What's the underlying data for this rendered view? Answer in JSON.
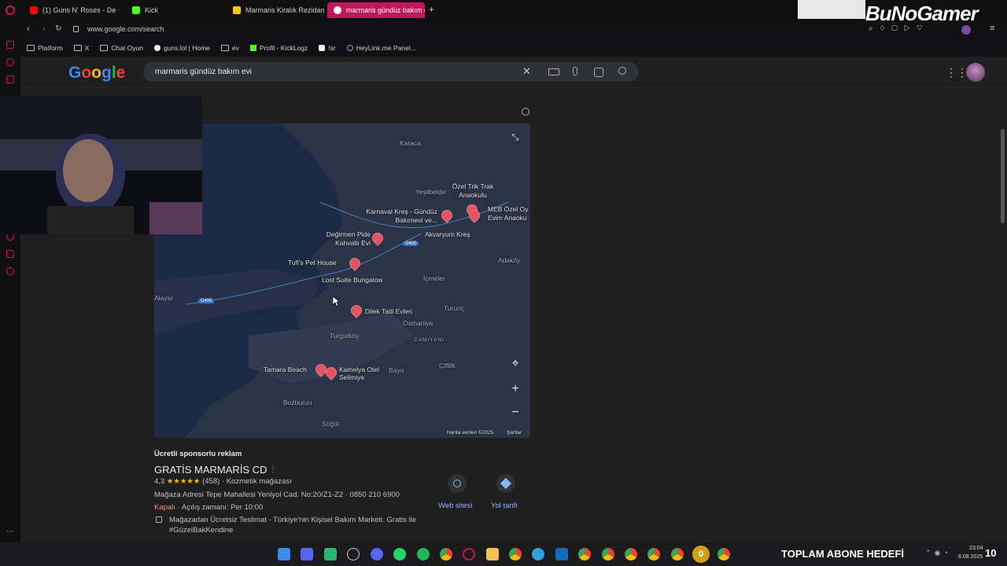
{
  "tabs": [
    {
      "label": "(1) Guns N' Roses - De",
      "color": "#ff0000"
    },
    {
      "label": "Kick",
      "color": "#53fc18"
    },
    {
      "label": "Marmaris Kiralık Rezidans",
      "color": "#f5c518"
    },
    {
      "label": "marmaris gündüz bakım e",
      "color": "#ffffff"
    }
  ],
  "new_tab": "+",
  "address": {
    "url": "www.google.com/search"
  },
  "bookmarks": [
    "Platform",
    "X",
    "Chat Oyun",
    "guns.lol | Home",
    "ev",
    "Profil - KickLogz",
    "!sr",
    "HeyLink.me Panel..."
  ],
  "overlay_brand": "BuNoGamer",
  "google": {
    "logo": "Google",
    "query": "marmaris gündüz bakım evi",
    "logo_colors": [
      "#4285f4",
      "#ea4335",
      "#fbbc05",
      "#4285f4",
      "#34a853",
      "#ea4335"
    ]
  },
  "map": {
    "labels": [
      {
        "text": "Karaca",
        "dim": true
      },
      {
        "text": "Özel Trik Trak Anaokulu",
        "dim": false
      },
      {
        "text": "Yeşilbelde",
        "dim": true
      },
      {
        "text": "Karnaval Kreş - Gündüz Bakımevi ve...",
        "dim": false
      },
      {
        "text": "MEB Özel Oy Evim Anaoku",
        "dim": false
      },
      {
        "text": "Değirmen Pide Kahvaltı Evi",
        "dim": false
      },
      {
        "text": "Akvaryum Kreş",
        "dim": false
      },
      {
        "text": "Tufi's Pet House",
        "dim": false
      },
      {
        "text": "Lost Suite Bungalow",
        "dim": false
      },
      {
        "text": "Adaköy",
        "dim": true
      },
      {
        "text": "İçmeler",
        "dim": true
      },
      {
        "text": "Alayar",
        "dim": true
      },
      {
        "text": "Dilek Tatil Evleri",
        "dim": false
      },
      {
        "text": "Turunç",
        "dim": true
      },
      {
        "text": "Osmaniye",
        "dim": true
      },
      {
        "text": "Turgutköy",
        "dim": true
      },
      {
        "text": "CAMIYANI",
        "dim": true
      },
      {
        "text": "Tamara Beach",
        "dim": false
      },
      {
        "text": "Kamelya Otel Selimiye",
        "dim": false
      },
      {
        "text": "Bayır",
        "dim": true
      },
      {
        "text": "Çiftlik",
        "dim": true
      },
      {
        "text": "Bozburun",
        "dim": true
      },
      {
        "text": "Söğüt",
        "dim": true
      }
    ],
    "road_label": "D400",
    "attribution": "Harita verileri ©2025",
    "terms": "Şartlar",
    "zoom_in": "+",
    "zoom_out": "−"
  },
  "ad": {
    "sponsored_label": "Ücretli sponsorlu reklam",
    "title": "GRATİS MARMARİS CD",
    "rating": "4,3",
    "stars": "★★★★★",
    "reviews": "(458)",
    "category": "· Kozmetik mağazası",
    "address": "Mağaza Adresi Tepe Mahallesi Yeniyol Cad. No:20/Z1-Z2 · 0850 210 6900",
    "status_closed": "Kapalı",
    "status_rest": "· Açılış zamanı: Per 10:00",
    "feature": "Mağazadan Ücretsiz Teslimat - Türkiye'nin Kişisel Bakım Marketi. Gratis ile #GüzelBakKendine",
    "website_label": "Web sitesi",
    "directions_label": "Yol tarifi"
  },
  "taskbar": {
    "ticker": "TOPLAM ABONE HEDEFİ",
    "counter": "0",
    "time": "23:04",
    "date": "6.08.2025",
    "badge": "10"
  }
}
